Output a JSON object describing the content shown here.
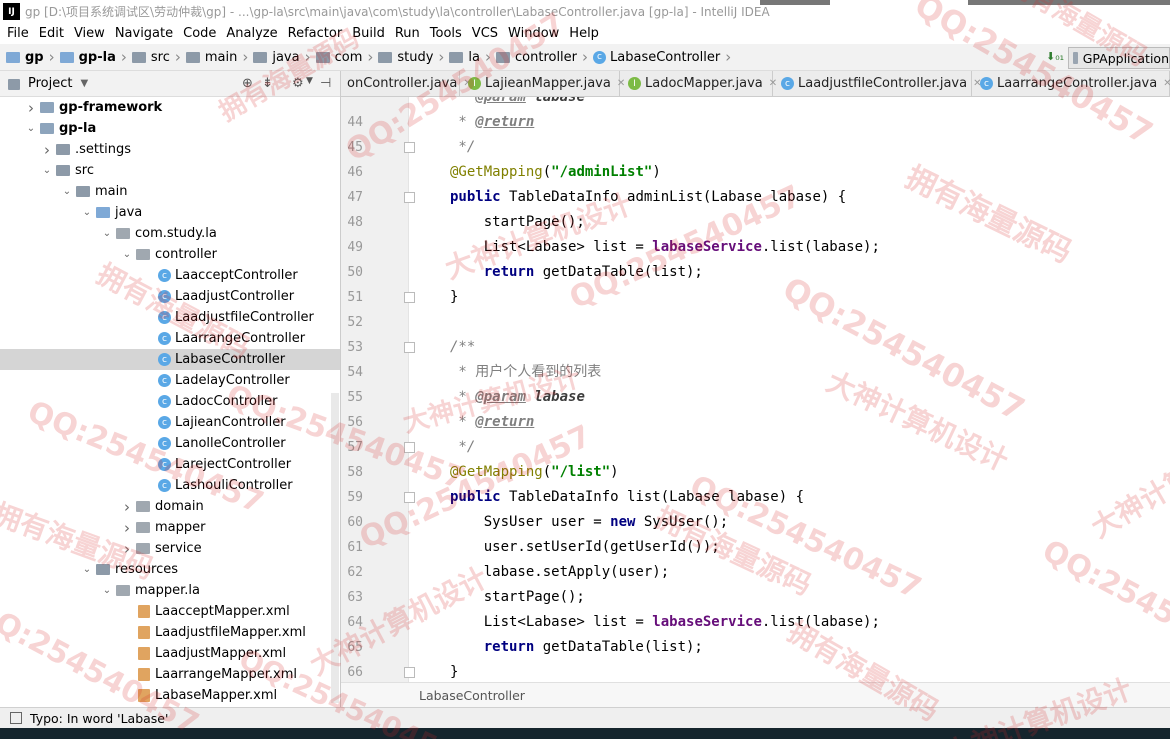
{
  "window": {
    "app_logo": "IJ",
    "title": "gp [D:\\项目系统调试区\\劳动仲裁\\gp] - ...\\gp-la\\src\\main\\java\\com\\study\\la\\controller\\LabaseController.java [gp-la] - IntelliJ IDEA"
  },
  "menu": [
    "File",
    "Edit",
    "View",
    "Navigate",
    "Code",
    "Analyze",
    "Refactor",
    "Build",
    "Run",
    "Tools",
    "VCS",
    "Window",
    "Help"
  ],
  "breadcrumbs": [
    "gp",
    "gp-la",
    "src",
    "main",
    "java",
    "com",
    "study",
    "la",
    "controller",
    "LabaseController"
  ],
  "run_config": "GPApplication",
  "project_panel": {
    "title": "Project"
  },
  "tree": [
    {
      "label": "gp-framework",
      "arrow": "›",
      "icon": "module-folder",
      "bold": true
    },
    {
      "label": "gp-la",
      "arrow": "⌄",
      "icon": "module-folder",
      "bold": true
    },
    {
      "label": ".settings",
      "arrow": "›",
      "icon": "folder"
    },
    {
      "label": "src",
      "arrow": "⌄",
      "icon": "folder"
    },
    {
      "label": "main",
      "arrow": "⌄",
      "icon": "folder"
    },
    {
      "label": "java",
      "arrow": "⌄",
      "icon": "source-folder"
    },
    {
      "label": "com.study.la",
      "arrow": "⌄",
      "icon": "package"
    },
    {
      "label": "controller",
      "arrow": "⌄",
      "icon": "package"
    },
    {
      "label": "LaacceptController",
      "arrow": "",
      "icon": "class"
    },
    {
      "label": "LaadjustController",
      "arrow": "",
      "icon": "class"
    },
    {
      "label": "LaadjustfileController",
      "arrow": "",
      "icon": "class"
    },
    {
      "label": "LaarrangeController",
      "arrow": "",
      "icon": "class"
    },
    {
      "label": "LabaseController",
      "arrow": "",
      "icon": "class",
      "selected": true
    },
    {
      "label": "LadelayController",
      "arrow": "",
      "icon": "class"
    },
    {
      "label": "LadocController",
      "arrow": "",
      "icon": "class"
    },
    {
      "label": "LajieanController",
      "arrow": "",
      "icon": "class"
    },
    {
      "label": "LanolleController",
      "arrow": "",
      "icon": "class"
    },
    {
      "label": "LarejectController",
      "arrow": "",
      "icon": "class"
    },
    {
      "label": "LashouliController",
      "arrow": "",
      "icon": "class"
    },
    {
      "label": "domain",
      "arrow": "›",
      "icon": "package"
    },
    {
      "label": "mapper",
      "arrow": "›",
      "icon": "package"
    },
    {
      "label": "service",
      "arrow": "›",
      "icon": "package"
    },
    {
      "label": "resources",
      "arrow": "⌄",
      "icon": "folder"
    },
    {
      "label": "mapper.la",
      "arrow": "⌄",
      "icon": "package"
    },
    {
      "label": "LaacceptMapper.xml",
      "arrow": "",
      "icon": "xml"
    },
    {
      "label": "LaadjustfileMapper.xml",
      "arrow": "",
      "icon": "xml"
    },
    {
      "label": "LaadjustMapper.xml",
      "arrow": "",
      "icon": "xml"
    },
    {
      "label": "LaarrangeMapper.xml",
      "arrow": "",
      "icon": "xml"
    },
    {
      "label": "LabaseMapper.xml",
      "arrow": "",
      "icon": "xml"
    }
  ],
  "tabs": [
    {
      "label": "onController.java",
      "icon": "class"
    },
    {
      "label": "LajieanMapper.java",
      "icon": "interface"
    },
    {
      "label": "LadocMapper.java",
      "icon": "interface"
    },
    {
      "label": "LaadjustfileController.java",
      "icon": "class"
    },
    {
      "label": "LaarrangeController.java",
      "icon": "class"
    }
  ],
  "code": [
    {
      "n": "",
      "segs": [
        {
          "c": "cmt",
          "t": " * "
        },
        {
          "c": "tag",
          "t": "@param"
        },
        {
          "c": "cmt",
          "t": " "
        },
        {
          "c": "pname",
          "t": "labase"
        }
      ]
    },
    {
      "n": "44",
      "segs": [
        {
          "c": "cmt",
          "t": " * "
        },
        {
          "c": "tag",
          "t": "@return"
        }
      ]
    },
    {
      "n": "45",
      "fold": true,
      "segs": [
        {
          "c": "cmt",
          "t": " */"
        }
      ]
    },
    {
      "n": "46",
      "segs": [
        {
          "c": "ann",
          "t": "@GetMapping"
        },
        {
          "c": "",
          "t": "("
        },
        {
          "c": "str",
          "t": "\"/adminList\""
        },
        {
          "c": "",
          "t": ")"
        }
      ]
    },
    {
      "n": "47",
      "fold": true,
      "segs": [
        {
          "c": "kw",
          "t": "public "
        },
        {
          "c": "",
          "t": "TableDataInfo adminList(Labase labase) {"
        }
      ]
    },
    {
      "n": "48",
      "segs": [
        {
          "c": "",
          "t": "    startPage();"
        }
      ]
    },
    {
      "n": "49",
      "segs": [
        {
          "c": "",
          "t": "    List<Labase> list = "
        },
        {
          "c": "field",
          "t": "labaseService"
        },
        {
          "c": "",
          "t": ".list(labase);"
        }
      ]
    },
    {
      "n": "50",
      "segs": [
        {
          "c": "kw",
          "t": "    return "
        },
        {
          "c": "",
          "t": "getDataTable(list);"
        }
      ]
    },
    {
      "n": "51",
      "fold": true,
      "segs": [
        {
          "c": "",
          "t": "}"
        }
      ]
    },
    {
      "n": "52",
      "segs": []
    },
    {
      "n": "53",
      "fold": true,
      "segs": [
        {
          "c": "cmt",
          "t": "/**"
        }
      ]
    },
    {
      "n": "54",
      "segs": [
        {
          "c": "cmt",
          "t": " * "
        },
        {
          "c": "cn",
          "t": "用户个人看到的列表"
        }
      ]
    },
    {
      "n": "55",
      "segs": [
        {
          "c": "cmt",
          "t": " * "
        },
        {
          "c": "tag",
          "t": "@param"
        },
        {
          "c": "cmt",
          "t": " "
        },
        {
          "c": "pname",
          "t": "labase"
        }
      ]
    },
    {
      "n": "56",
      "segs": [
        {
          "c": "cmt",
          "t": " * "
        },
        {
          "c": "tag",
          "t": "@return"
        }
      ]
    },
    {
      "n": "57",
      "fold": true,
      "segs": [
        {
          "c": "cmt",
          "t": " */"
        }
      ]
    },
    {
      "n": "58",
      "segs": [
        {
          "c": "ann",
          "t": "@GetMapping"
        },
        {
          "c": "",
          "t": "("
        },
        {
          "c": "str",
          "t": "\"/list\""
        },
        {
          "c": "",
          "t": ")"
        }
      ]
    },
    {
      "n": "59",
      "fold": true,
      "segs": [
        {
          "c": "kw",
          "t": "public "
        },
        {
          "c": "",
          "t": "TableDataInfo list(Labase labase) {"
        }
      ]
    },
    {
      "n": "60",
      "segs": [
        {
          "c": "",
          "t": "    SysUser user = "
        },
        {
          "c": "kw",
          "t": "new "
        },
        {
          "c": "",
          "t": "SysUser();"
        }
      ]
    },
    {
      "n": "61",
      "segs": [
        {
          "c": "",
          "t": "    user.setUserId(getUserId());"
        }
      ]
    },
    {
      "n": "62",
      "segs": [
        {
          "c": "",
          "t": "    labase.setApply(user);"
        }
      ]
    },
    {
      "n": "63",
      "segs": [
        {
          "c": "",
          "t": "    startPage();"
        }
      ]
    },
    {
      "n": "64",
      "segs": [
        {
          "c": "",
          "t": "    List<Labase> list = "
        },
        {
          "c": "field",
          "t": "labaseService"
        },
        {
          "c": "",
          "t": ".list(labase);"
        }
      ]
    },
    {
      "n": "65",
      "segs": [
        {
          "c": "kw",
          "t": "    return "
        },
        {
          "c": "",
          "t": "getDataTable(list);"
        }
      ]
    },
    {
      "n": "66",
      "fold": true,
      "segs": [
        {
          "c": "",
          "t": "}"
        }
      ]
    }
  ],
  "editor_breadcrumb": "LabaseController",
  "status": {
    "message": "Typo: In word 'Labase'"
  },
  "watermark": {
    "qq": "QQ:254540457",
    "brand": "拥有海量源码",
    "master": "大神计算机设计",
    "color": "#d72828"
  }
}
